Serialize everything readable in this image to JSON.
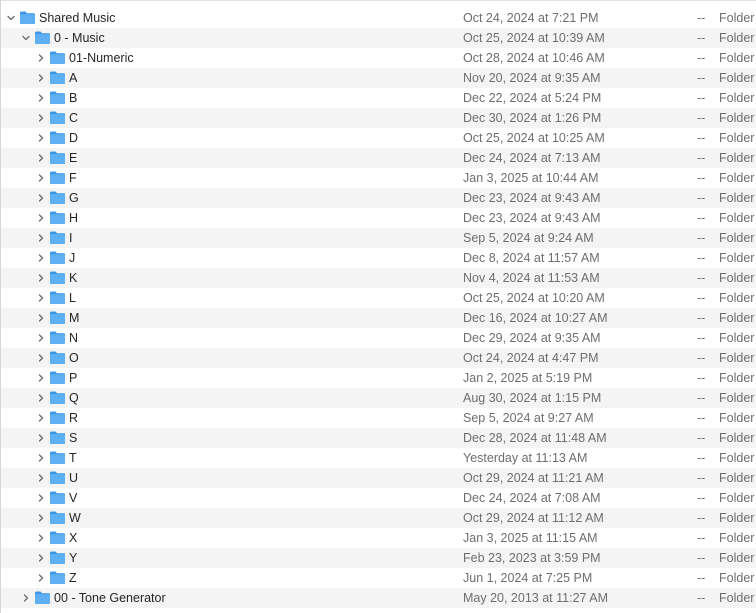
{
  "columns": {
    "size_placeholder": "--",
    "kind": "Folder"
  },
  "rows": [
    {
      "name": "Shared Music",
      "date": "Oct 24, 2024 at 7:21 PM",
      "level": 0,
      "expanded": true,
      "icon": "folder-icon"
    },
    {
      "name": "0 - Music",
      "date": "Oct 25, 2024 at 10:39 AM",
      "level": 1,
      "expanded": true,
      "icon": "folder-icon"
    },
    {
      "name": "01-Numeric",
      "date": "Oct 28, 2024 at 10:46 AM",
      "level": 2,
      "expanded": false,
      "icon": "folder-icon"
    },
    {
      "name": "A",
      "date": "Nov 20, 2024 at 9:35 AM",
      "level": 2,
      "expanded": false,
      "icon": "folder-icon"
    },
    {
      "name": "B",
      "date": "Dec 22, 2024 at 5:24 PM",
      "level": 2,
      "expanded": false,
      "icon": "folder-icon"
    },
    {
      "name": "C",
      "date": "Dec 30, 2024 at 1:26 PM",
      "level": 2,
      "expanded": false,
      "icon": "folder-icon"
    },
    {
      "name": "D",
      "date": "Oct 25, 2024 at 10:25 AM",
      "level": 2,
      "expanded": false,
      "icon": "folder-icon"
    },
    {
      "name": "E",
      "date": "Dec 24, 2024 at 7:13 AM",
      "level": 2,
      "expanded": false,
      "icon": "folder-icon"
    },
    {
      "name": "F",
      "date": "Jan 3, 2025 at 10:44 AM",
      "level": 2,
      "expanded": false,
      "icon": "folder-icon"
    },
    {
      "name": "G",
      "date": "Dec 23, 2024 at 9:43 AM",
      "level": 2,
      "expanded": false,
      "icon": "folder-icon"
    },
    {
      "name": "H",
      "date": "Dec 23, 2024 at 9:43 AM",
      "level": 2,
      "expanded": false,
      "icon": "folder-icon"
    },
    {
      "name": "I",
      "date": "Sep 5, 2024 at 9:24 AM",
      "level": 2,
      "expanded": false,
      "icon": "folder-icon"
    },
    {
      "name": "J",
      "date": "Dec 8, 2024 at 11:57 AM",
      "level": 2,
      "expanded": false,
      "icon": "folder-icon"
    },
    {
      "name": "K",
      "date": "Nov 4, 2024 at 11:53 AM",
      "level": 2,
      "expanded": false,
      "icon": "folder-icon"
    },
    {
      "name": "L",
      "date": "Oct 25, 2024 at 10:20 AM",
      "level": 2,
      "expanded": false,
      "icon": "folder-icon"
    },
    {
      "name": "M",
      "date": "Dec 16, 2024 at 10:27 AM",
      "level": 2,
      "expanded": false,
      "icon": "folder-icon"
    },
    {
      "name": "N",
      "date": "Dec 29, 2024 at 9:35 AM",
      "level": 2,
      "expanded": false,
      "icon": "folder-icon"
    },
    {
      "name": "O",
      "date": "Oct 24, 2024 at 4:47 PM",
      "level": 2,
      "expanded": false,
      "icon": "folder-icon"
    },
    {
      "name": "P",
      "date": "Jan 2, 2025 at 5:19 PM",
      "level": 2,
      "expanded": false,
      "icon": "folder-icon"
    },
    {
      "name": "Q",
      "date": "Aug 30, 2024 at 1:15 PM",
      "level": 2,
      "expanded": false,
      "icon": "folder-icon"
    },
    {
      "name": "R",
      "date": "Sep 5, 2024 at 9:27 AM",
      "level": 2,
      "expanded": false,
      "icon": "folder-icon"
    },
    {
      "name": "S",
      "date": "Dec 28, 2024 at 11:48 AM",
      "level": 2,
      "expanded": false,
      "icon": "folder-icon"
    },
    {
      "name": "T",
      "date": "Yesterday at 11:13 AM",
      "level": 2,
      "expanded": false,
      "icon": "folder-icon"
    },
    {
      "name": "U",
      "date": "Oct 29, 2024 at 11:21 AM",
      "level": 2,
      "expanded": false,
      "icon": "folder-icon"
    },
    {
      "name": "V",
      "date": "Dec 24, 2024 at 7:08 AM",
      "level": 2,
      "expanded": false,
      "icon": "folder-icon"
    },
    {
      "name": "W",
      "date": "Oct 29, 2024 at 11:12 AM",
      "level": 2,
      "expanded": false,
      "icon": "folder-icon"
    },
    {
      "name": "X",
      "date": "Jan 3, 2025 at 11:15 AM",
      "level": 2,
      "expanded": false,
      "icon": "folder-icon"
    },
    {
      "name": "Y",
      "date": "Feb 23, 2023 at 3:59 PM",
      "level": 2,
      "expanded": false,
      "icon": "folder-icon"
    },
    {
      "name": "Z",
      "date": "Jun 1, 2024 at 7:25 PM",
      "level": 2,
      "expanded": false,
      "icon": "folder-icon"
    },
    {
      "name": "00 - Tone Generator",
      "date": "May 20, 2013 at 11:27 AM",
      "level": 1,
      "expanded": false,
      "icon": "folder-icon"
    }
  ],
  "colors": {
    "folder": "#5fb0f2",
    "folder_tab": "#3d97e6",
    "row_alt": "#f4f4f5",
    "chevron": "#6b6b6b"
  }
}
